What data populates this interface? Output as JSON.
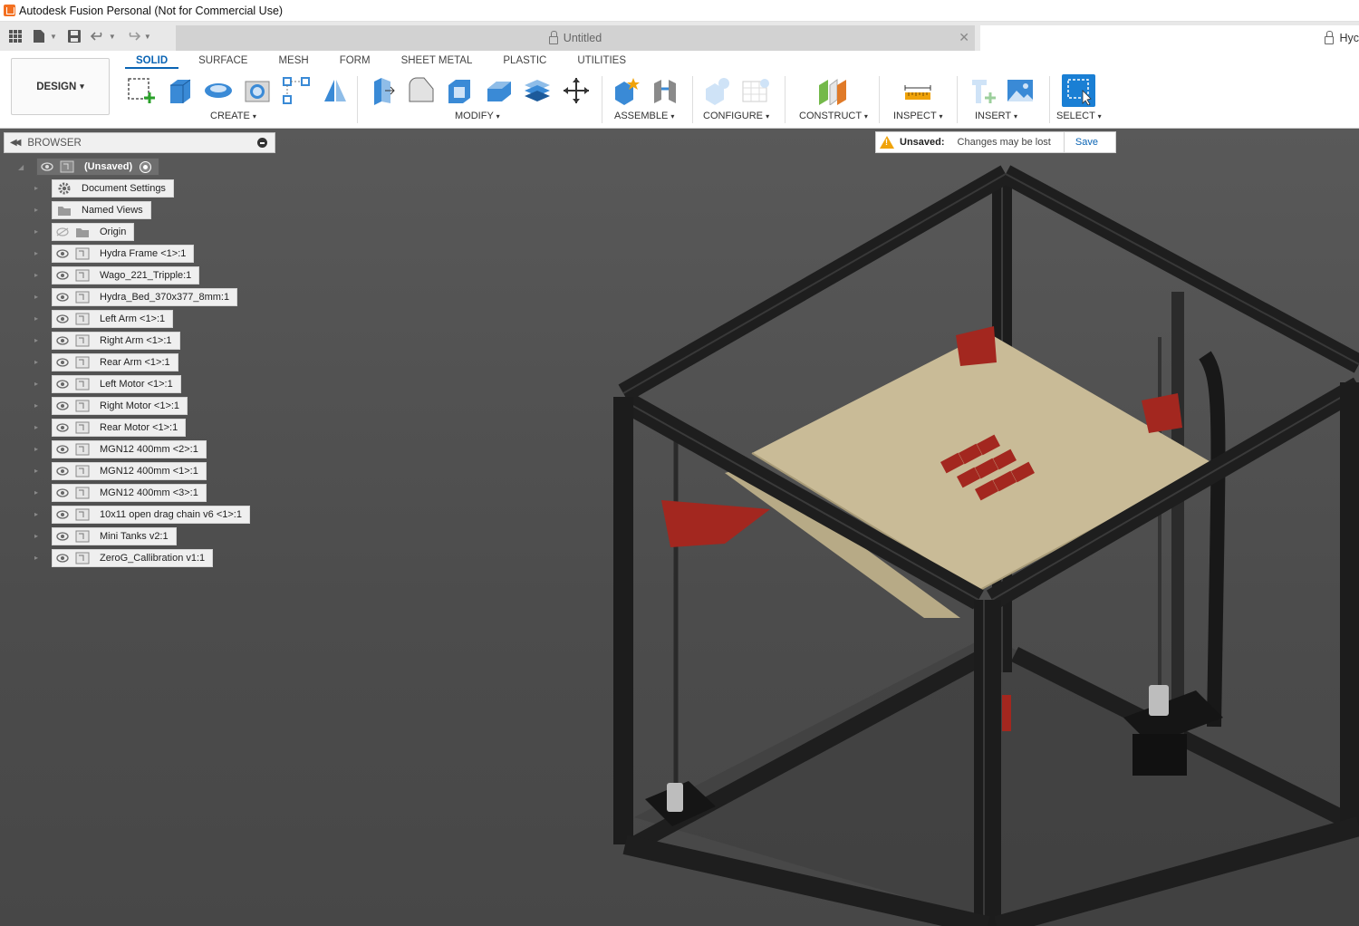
{
  "app": {
    "title": "Autodesk Fusion Personal (Not for Commercial Use)"
  },
  "tabs": {
    "active_doc": "Untitled",
    "other_doc": "Hyc"
  },
  "toolbar": {
    "design_label": "DESIGN",
    "caret": "▾",
    "workspace_tabs": [
      "SOLID",
      "SURFACE",
      "MESH",
      "FORM",
      "SHEET METAL",
      "PLASTIC",
      "UTILITIES"
    ],
    "groups": {
      "create": "CREATE",
      "modify": "MODIFY",
      "assemble": "ASSEMBLE",
      "configure": "CONFIGURE",
      "construct": "CONSTRUCT",
      "inspect": "INSPECT",
      "insert": "INSERT",
      "select": "SELECT"
    }
  },
  "browser": {
    "title": "BROWSER",
    "root": "(Unsaved)",
    "items": [
      "Document Settings",
      "Named Views",
      "Origin",
      "Hydra Frame <1>:1",
      "Wago_221_Tripple:1",
      "Hydra_Bed_370x377_8mm:1",
      "Left Arm <1>:1",
      "Right Arm <1>:1",
      "Rear Arm <1>:1",
      "Left Motor <1>:1",
      "Right Motor <1>:1",
      "Rear Motor <1>:1",
      "MGN12 400mm <2>:1",
      "MGN12 400mm <1>:1",
      "MGN12 400mm <3>:1",
      "10x11 open drag chain v6 <1>:1",
      "Mini Tanks v2:1",
      "ZeroG_Callibration v1:1"
    ]
  },
  "notice": {
    "label": "Unsaved:",
    "message": "Changes may be lost",
    "action": "Save"
  },
  "colors": {
    "accent": "#0a64b4",
    "bed": "#c9bb97",
    "frame": "#1e1e1e",
    "parts": "#a3271f"
  }
}
